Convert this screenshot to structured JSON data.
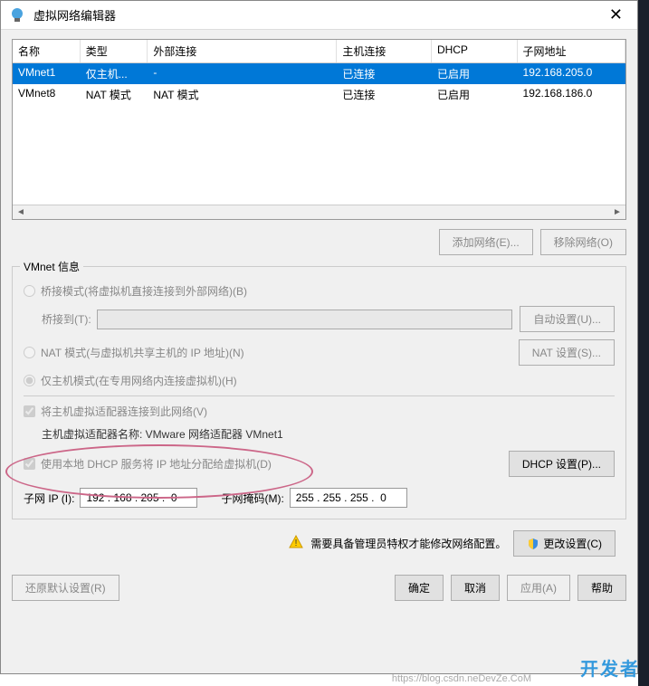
{
  "window": {
    "title": "虚拟网络编辑器"
  },
  "table": {
    "headers": {
      "name": "名称",
      "type": "类型",
      "ext": "外部连接",
      "host": "主机连接",
      "dhcp": "DHCP",
      "subnet": "子网地址"
    },
    "rows": [
      {
        "name": "VMnet1",
        "type": "仅主机...",
        "ext": "-",
        "host": "已连接",
        "dhcp": "已启用",
        "subnet": "192.168.205.0",
        "selected": true
      },
      {
        "name": "VMnet8",
        "type": "NAT 模式",
        "ext": "NAT 模式",
        "host": "已连接",
        "dhcp": "已启用",
        "subnet": "192.168.186.0",
        "selected": false
      }
    ]
  },
  "buttons": {
    "addNetwork": "添加网络(E)...",
    "removeNetwork": "移除网络(O)",
    "autoSettings": "自动设置(U)...",
    "natSettings": "NAT 设置(S)...",
    "dhcpSettings": "DHCP 设置(P)...",
    "changeSettings": "更改设置(C)",
    "restoreDefault": "还原默认设置(R)",
    "ok": "确定",
    "cancel": "取消",
    "apply": "应用(A)",
    "help": "帮助"
  },
  "vmnetInfo": {
    "groupTitle": "VMnet 信息",
    "bridgeMode": "桥接模式(将虚拟机直接连接到外部网络)(B)",
    "bridgeTo": "桥接到(T):",
    "natMode": "NAT 模式(与虚拟机共享主机的 IP 地址)(N)",
    "hostOnly": "仅主机模式(在专用网络内连接虚拟机)(H)",
    "connectHost": "将主机虚拟适配器连接到此网络(V)",
    "adapterName": "主机虚拟适配器名称: VMware 网络适配器 VMnet1",
    "useDhcp": "使用本地 DHCP 服务将 IP 地址分配给虚拟机(D)",
    "subnetIpLabel": "子网 IP (I):",
    "subnetIp": "192 . 168 . 205 .  0",
    "subnetMaskLabel": "子网掩码(M):",
    "subnetMask": "255 . 255 . 255 .  0"
  },
  "adminNote": "需要具备管理员特权才能修改网络配置。",
  "watermark": "开发者",
  "watermarkUrl": "https://blog.csdn.neDevZe.CoM"
}
